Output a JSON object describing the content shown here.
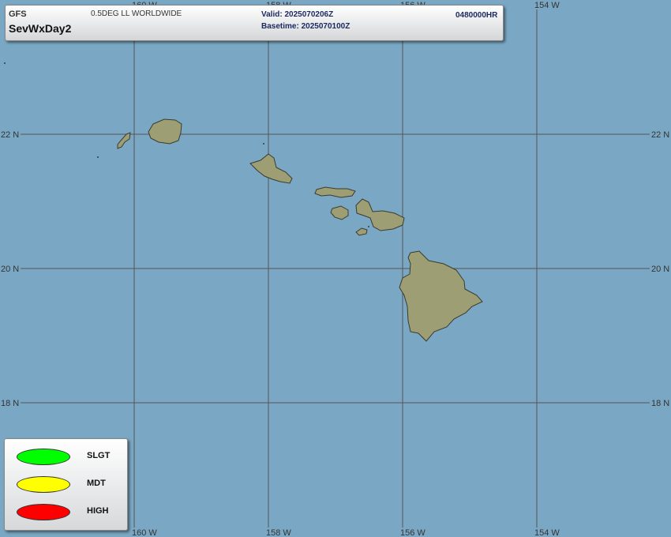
{
  "header": {
    "model": "GFS",
    "product": "SevWxDay2",
    "grid": "0.5DEG LL WORLDWIDE",
    "valid": "Valid: 2025070206Z",
    "basetime": "Basetime: 2025070100Z",
    "forecast_hour": "0480000HR"
  },
  "map": {
    "lon_labels": [
      {
        "label": "160 W"
      },
      {
        "label": "158 W"
      },
      {
        "label": "156 W"
      },
      {
        "label": "154 W"
      }
    ],
    "lat_labels": [
      {
        "label": "22 N"
      },
      {
        "label": "20 N"
      },
      {
        "label": "18 N"
      }
    ],
    "islands": [
      "Niihau",
      "Kauai",
      "Oahu",
      "Molokai",
      "Lanai",
      "Maui",
      "Kahoolawe",
      "Hawaii"
    ],
    "ocean_color": "#7aa8c4",
    "land_color": "#9e9e74"
  },
  "legend": {
    "items": [
      {
        "label": "SLGT",
        "color": "#00ff00"
      },
      {
        "label": "MDT",
        "color": "#ffff00"
      },
      {
        "label": "HIGH",
        "color": "#ff0000"
      }
    ]
  }
}
